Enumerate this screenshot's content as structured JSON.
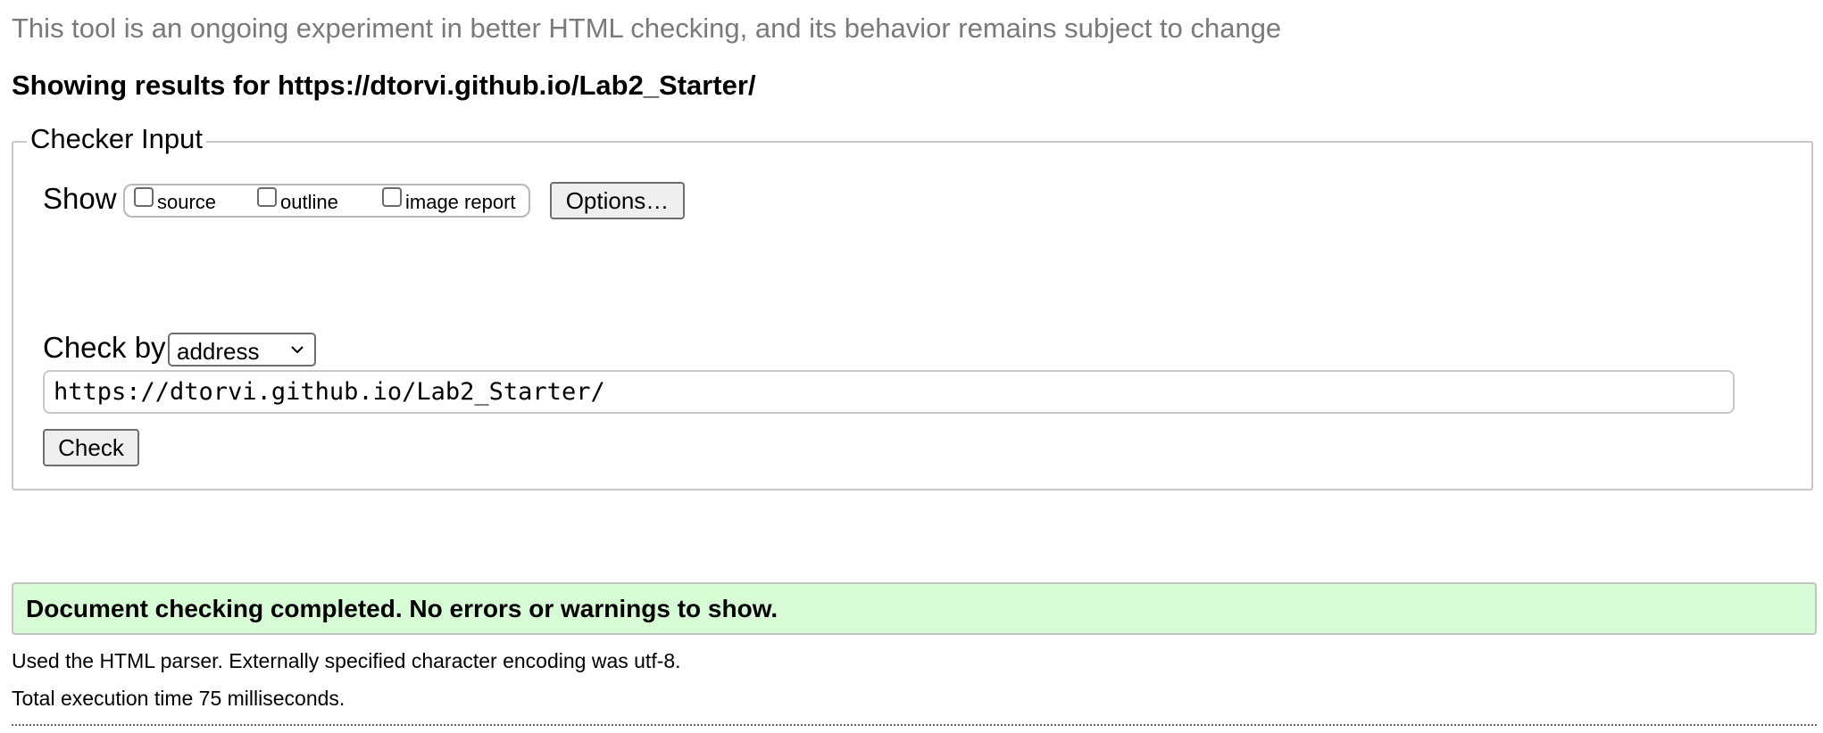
{
  "header": {
    "disclaimer": "This tool is an ongoing experiment in better HTML checking, and its behavior remains subject to change",
    "results_for": "Showing results for https://dtorvi.github.io/Lab2_Starter/"
  },
  "checker_input": {
    "legend": "Checker Input",
    "show_label": "Show",
    "show_options": [
      {
        "label": "source",
        "checked": false
      },
      {
        "label": "outline",
        "checked": false
      },
      {
        "label": "image report",
        "checked": false
      }
    ],
    "options_button": "Options…",
    "check_by_label": "Check by",
    "check_by_selected": "address",
    "url_value": "https://dtorvi.github.io/Lab2_Starter/",
    "check_button": "Check"
  },
  "result": {
    "message": "Document checking completed. No errors or warnings to show.",
    "success_color": "#d7fcd5",
    "parser_info": "Used the HTML parser. Externally specified character encoding was utf-8.",
    "execution_time": "Total execution time 75 milliseconds."
  }
}
